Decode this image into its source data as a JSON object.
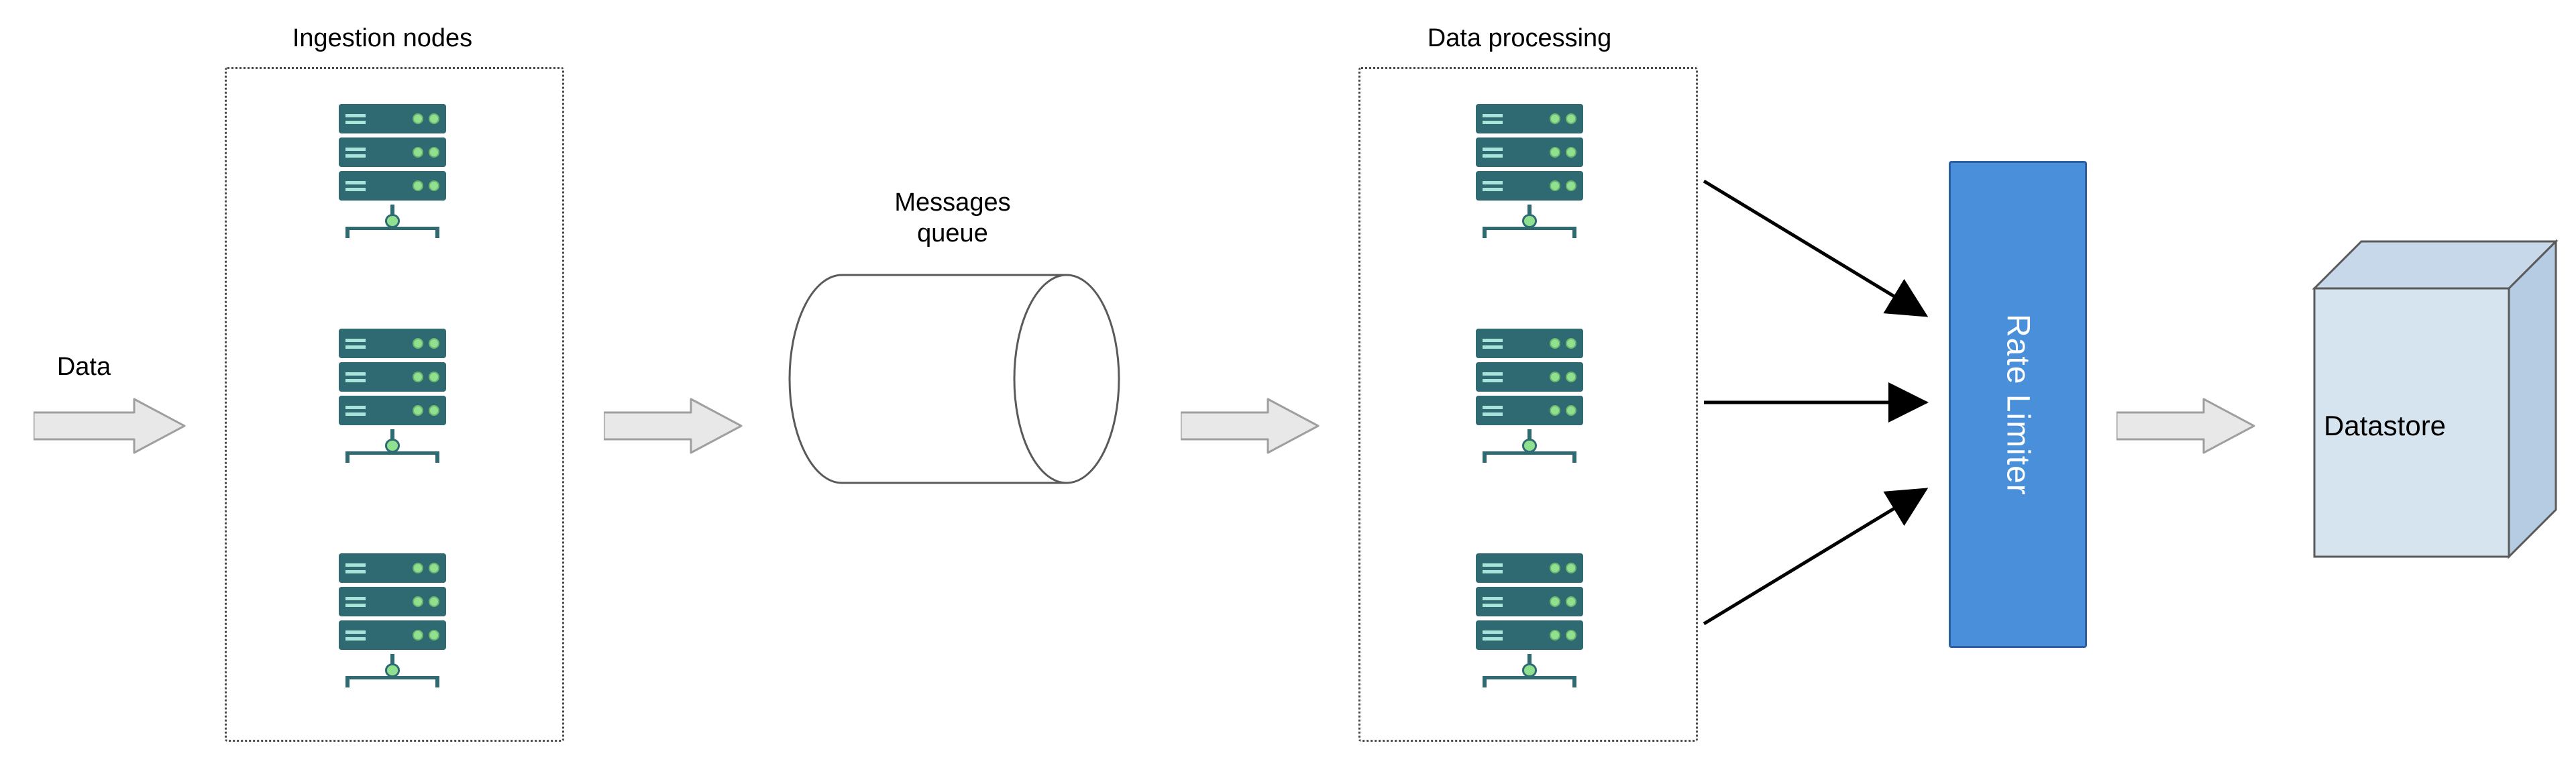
{
  "labels": {
    "data": "Data",
    "ingestion": "Ingestion nodes",
    "queue_line1": "Messages",
    "queue_line2": "queue",
    "processing": "Data processing",
    "rate_limiter": "Rate Limiter",
    "datastore": "Datastore"
  },
  "diagram": {
    "flow": [
      "Data",
      "Ingestion nodes",
      "Messages queue",
      "Data processing",
      "Rate Limiter",
      "Datastore"
    ],
    "arrows": [
      {
        "from": "Data",
        "to": "Ingestion nodes",
        "style": "block"
      },
      {
        "from": "Ingestion nodes",
        "to": "Messages queue",
        "style": "block"
      },
      {
        "from": "Messages queue",
        "to": "Data processing",
        "style": "block"
      },
      {
        "from": "Data processing (3 nodes)",
        "to": "Rate Limiter",
        "style": "thin-fanin"
      },
      {
        "from": "Rate Limiter",
        "to": "Datastore",
        "style": "block"
      }
    ],
    "clusters": {
      "Ingestion nodes": {
        "node_count": 3
      },
      "Data processing": {
        "node_count": 3
      }
    },
    "colors": {
      "server_body": "#2f6a72",
      "server_led": "#8fe08f",
      "rate_limiter_fill": "#4a8fd9",
      "rate_limiter_border": "#2b5fa1",
      "datastore_fill": "#d6e4f0",
      "datastore_stroke": "#5a5a5a",
      "block_arrow": "#e8e8e8"
    }
  }
}
